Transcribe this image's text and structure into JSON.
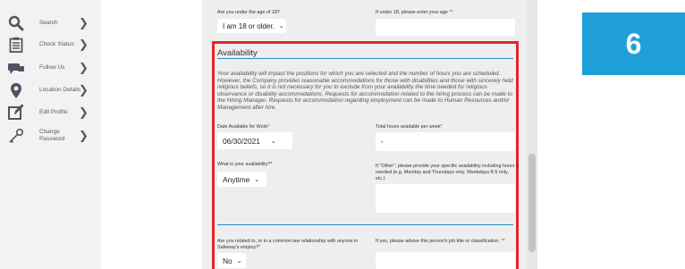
{
  "sidebar": {
    "items": [
      {
        "label": "Search",
        "icon": "search-icon"
      },
      {
        "label": "Check Status",
        "icon": "clipboard-icon"
      },
      {
        "label": "Follow Us",
        "icon": "megaphone-icon"
      },
      {
        "label": "Location Details",
        "icon": "map-pin-icon"
      },
      {
        "label": "Edit Profile",
        "icon": "edit-icon"
      },
      {
        "label": "Change Password",
        "icon": "key-icon"
      }
    ]
  },
  "step_number": "6",
  "age": {
    "question": "Are you under the age of 18?",
    "answer": "I am 18 or older.",
    "followup_label": "If under 18, please enter your age",
    "followup_required_mark": "**",
    "followup_value": ""
  },
  "availability": {
    "title": "Availability",
    "description": "Your availability will impact the positions for which you are selected and the number of hours you are scheduled. However, the Company provides reasonable accommodations for those with disabilities and those with sincerely held religious beliefs, so it is not necessary for you to exclude from your availability the time needed for religious observance or disability accommodations. Requests for accommodation related to the hiring process can be made to the Hiring Manager. Requests for accommodation regarding employment can be made to Human Resources and/or Management after hire.",
    "date_label": "Date Available for Work",
    "date_value": "06/30/2021",
    "hours_label": "Total hours available per week",
    "hours_value": "-",
    "avail_label": "What is your availability?",
    "avail_value": "Anytime",
    "other_label": "If \"Other\", please provide your specific availability including hours if needed (e.g. Monday and Thursdays only, Weekdays 8-5 only, etc.)",
    "other_value": "",
    "related_label": "Are you related to, or in a common law relationship with anyone in Safeway's employ?",
    "related_value": "No",
    "related_followup_label": "If yes, please advise this person's job title or classification.",
    "related_followup_required_mark": "**",
    "related_followup_value": "",
    "required_mark": "*"
  },
  "colors": {
    "accent_blue": "#1fa0d8",
    "highlight_red": "#e32528",
    "required_red": "#e02020"
  }
}
